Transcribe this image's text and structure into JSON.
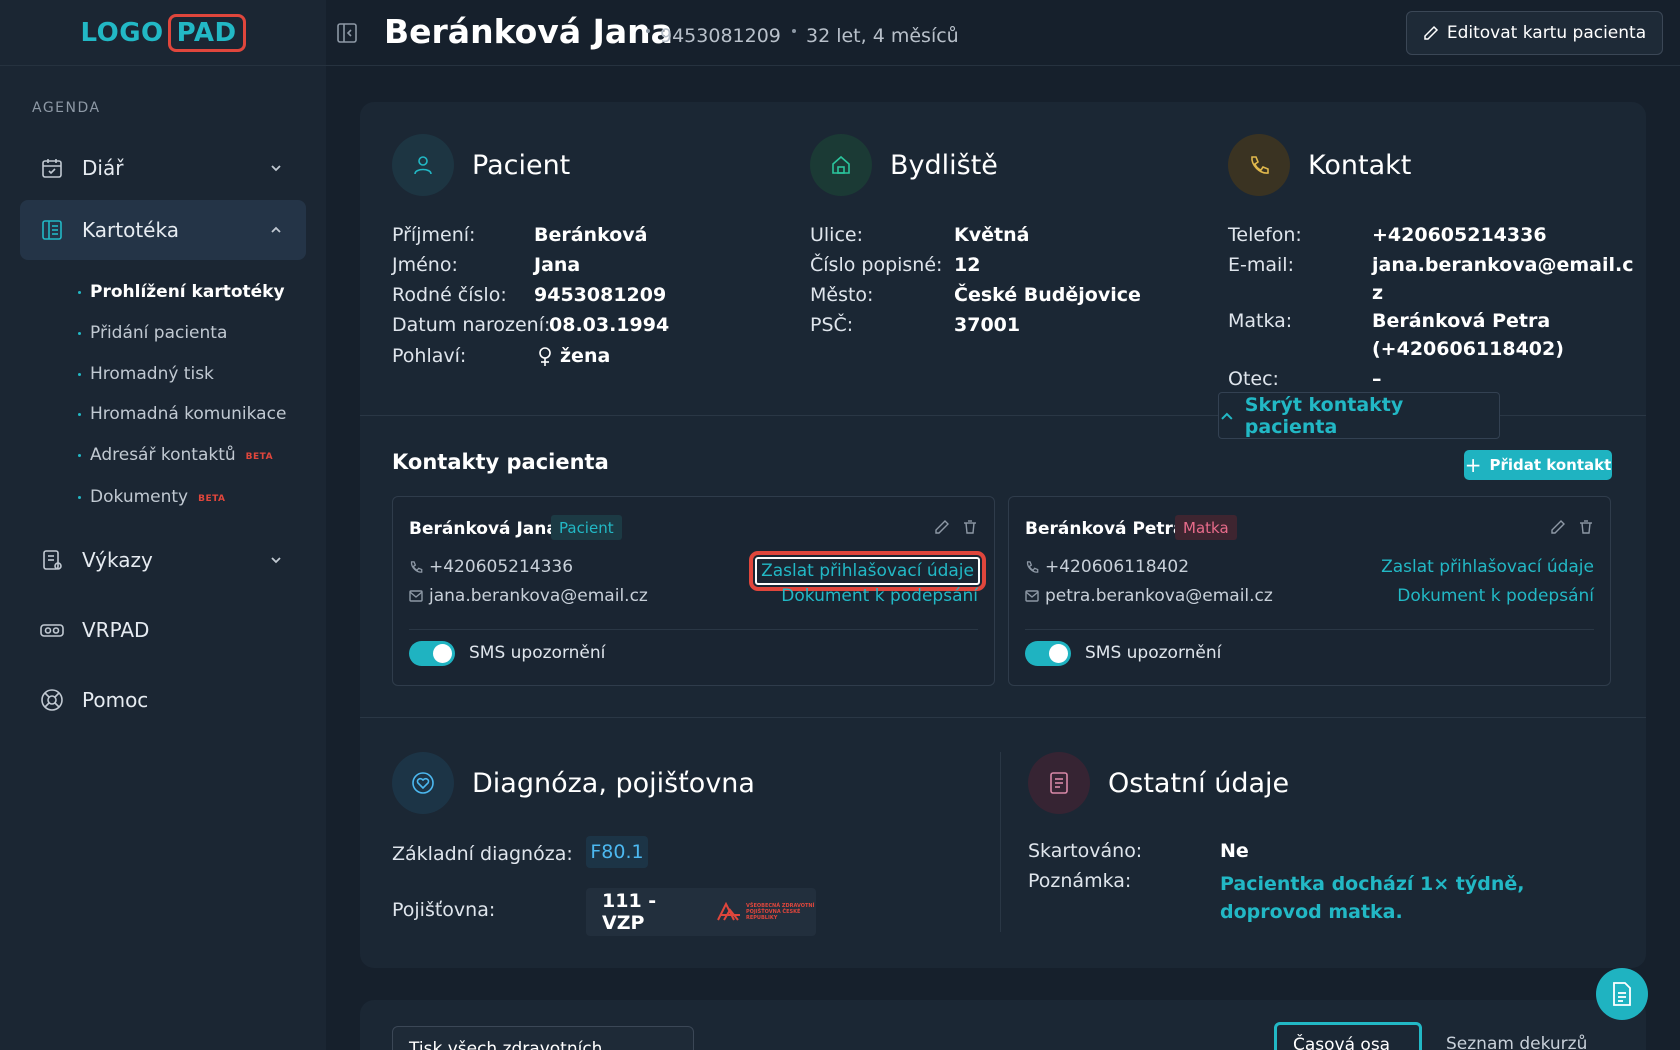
{
  "logo": {
    "part1": "LOGO",
    "part2": "PAD"
  },
  "sidebar": {
    "section_label": "AGENDA",
    "items": [
      {
        "label": "Diář",
        "icon": "calendar-icon"
      },
      {
        "label": "Kartotéka",
        "icon": "book-icon"
      },
      {
        "label": "Výkazy",
        "icon": "report-icon"
      },
      {
        "label": "VRPAD",
        "icon": "vr-headset-icon"
      },
      {
        "label": "Pomoc",
        "icon": "lifebuoy-icon"
      }
    ],
    "sub_items": [
      {
        "label": "Prohlížení kartotéky"
      },
      {
        "label": "Přidání pacienta"
      },
      {
        "label": "Hromadný tisk"
      },
      {
        "label": "Hromadná komunikace"
      },
      {
        "label": "Adresář kontaktů",
        "badge": "BETA"
      },
      {
        "label": "Dokumenty",
        "badge": "BETA"
      }
    ]
  },
  "header": {
    "title": "Beránková Jana",
    "id": "9453081209",
    "age": "32 let, 4 měsíců",
    "edit_label": "Editovat kartu pacienta"
  },
  "patient": {
    "heading": "Pacient",
    "fields": [
      {
        "label": "Příjmení:",
        "value": "Beránková"
      },
      {
        "label": "Jméno:",
        "value": "Jana"
      },
      {
        "label": "Rodné číslo:",
        "value": "9453081209"
      },
      {
        "label": "Datum narození:",
        "value": "08.03.1994"
      },
      {
        "label": "Pohlaví:",
        "value": "žena"
      }
    ]
  },
  "address": {
    "heading": "Bydliště",
    "fields": [
      {
        "label": "Ulice:",
        "value": "Květná"
      },
      {
        "label": "Číslo popisné:",
        "value": "12"
      },
      {
        "label": "Město:",
        "value": "České Budějovice"
      },
      {
        "label": "PSČ:",
        "value": "37001"
      }
    ]
  },
  "contact": {
    "heading": "Kontakt",
    "fields": [
      {
        "label": "Telefon:",
        "value": "+420605214336"
      },
      {
        "label": "E-mail:",
        "value": "jana.berankova@email.c",
        "value2": "z"
      },
      {
        "label": "Matka:",
        "value": "Beránková Petra",
        "value2": "(+420606118402)"
      },
      {
        "label": "Otec:",
        "value": "–"
      }
    ],
    "hide_label": "Skrýt kontakty pacienta"
  },
  "contacts_section": {
    "title": "Kontakty pacienta",
    "add_label": "Přidat kontakt",
    "cards": [
      {
        "name": "Beránková Jana",
        "tag": "Pacient",
        "phone": "+420605214336",
        "email": "jana.berankova@email.cz",
        "link1": "Zaslat přihlašovací údaje",
        "link2": "Dokument k podepsání",
        "sms_label": "SMS upozornění",
        "sms_on": true
      },
      {
        "name": "Beránková Petra",
        "tag": "Matka",
        "phone": "+420606118402",
        "email": "petra.berankova@email.cz",
        "link1": "Zaslat přihlašovací údaje",
        "link2": "Dokument k podepsání",
        "sms_label": "SMS upozornění",
        "sms_on": true
      }
    ]
  },
  "diagnosis": {
    "heading": "Diagnóza, pojišťovna",
    "diag_label": "Základní diagnóza:",
    "diag_value": "F80.1",
    "ins_label": "Pojišťovna:",
    "ins_value": "111 - VZP",
    "ins_logo_text": "VŠEOBECNÁ ZDRAVOTNÍ POJIŠŤOVNA ČESKÉ REPUBLIKY"
  },
  "other": {
    "heading": "Ostatní údaje",
    "shred_label": "Skartováno:",
    "shred_value": "Ne",
    "note_label": "Poznámka:",
    "note_value": "Pacientka dochází 1× týdně, doprovod matka."
  },
  "bottom": {
    "print_label": "Tisk všech zdravotních záznamů",
    "timeline_label": "Časová osa",
    "list_label": "Seznam dekurzů"
  },
  "colors": {
    "accent": "#1fb3c1",
    "highlight": "#e0463c",
    "bg": "#16202c"
  }
}
